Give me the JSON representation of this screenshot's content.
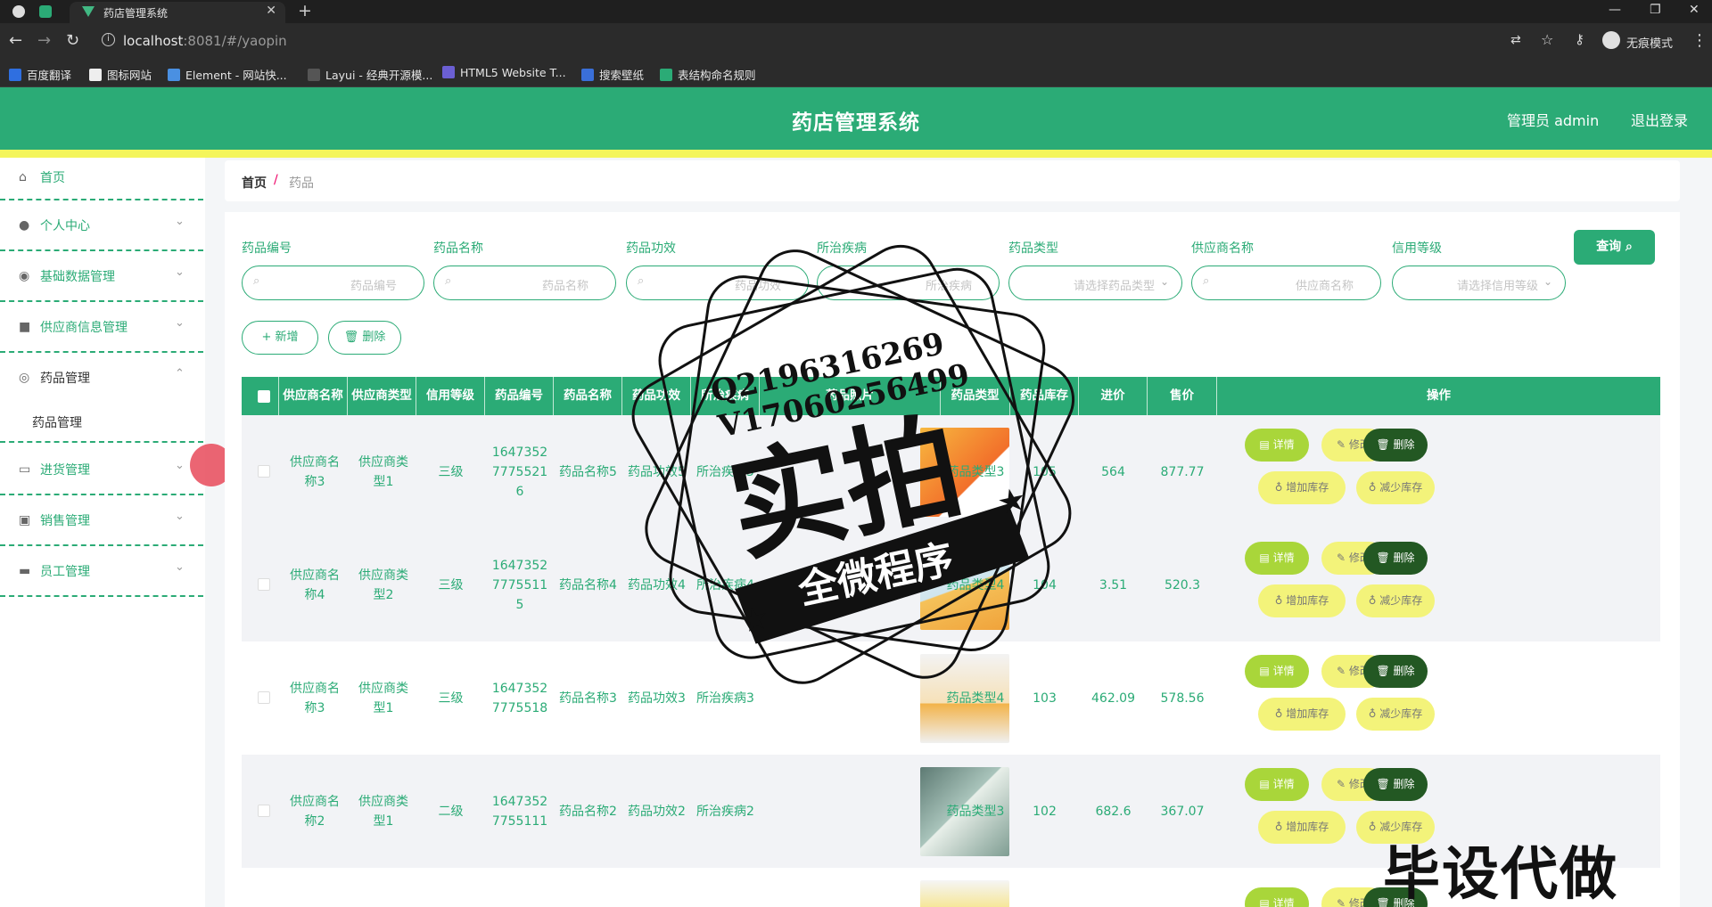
{
  "browser": {
    "tab_title": "药店管理系统",
    "url_host": "localhost",
    "url_rest": ":8081/#/yaopin",
    "incognito_label": "无痕模式",
    "bookmarks": [
      "百度翻译",
      "图标网站",
      "Element - 网站快...",
      "Layui - 经典开源模...",
      "HTML5 Website T...",
      "搜索壁纸",
      "表结构命名规则"
    ]
  },
  "header": {
    "title": "药店管理系统",
    "admin_label": "管理员 admin",
    "logout_label": "退出登录"
  },
  "sidebar": {
    "items": [
      {
        "label": "首页",
        "icon": "home-icon"
      },
      {
        "label": "个人中心",
        "icon": "user-icon"
      },
      {
        "label": "基础数据管理",
        "icon": "bulb-icon"
      },
      {
        "label": "供应商信息管理",
        "icon": "folder-icon"
      },
      {
        "label": "药品管理",
        "icon": "globe-icon"
      },
      {
        "label": "进货管理",
        "icon": "chat-icon"
      },
      {
        "label": "销售管理",
        "icon": "clipboard-icon"
      },
      {
        "label": "员工管理",
        "icon": "card-icon"
      }
    ],
    "submenu_label": "药品管理"
  },
  "breadcrumb": {
    "home": "首页",
    "separator": "/",
    "current": "药品"
  },
  "filters": {
    "labels": [
      "药品编号",
      "药品名称",
      "药品功效",
      "所治疾病",
      "药品类型",
      "供应商名称",
      "信用等级"
    ],
    "placeholders": [
      "药品编号",
      "药品名称",
      "药品功效",
      "所治疾病",
      "请选择药品类型",
      "供应商名称",
      "请选择信用等级"
    ],
    "query_label": "查询"
  },
  "actions": {
    "add_label": "+ 新增",
    "delete_label": "删除"
  },
  "table": {
    "headers": [
      "供应商名称",
      "供应商类型",
      "信用等级",
      "药品编号",
      "药品名称",
      "药品功效",
      "所治疾病",
      "药品照片",
      "药品类型",
      "药品库存",
      "进价",
      "售价",
      "操作"
    ],
    "rows": [
      {
        "supplier": "供应商名称3",
        "supplier_type": "供应商类型1",
        "credit": "三级",
        "code": "164735277755216",
        "name": "药品名称5",
        "effect": "药品功效5",
        "disease": "所治疾病5",
        "type": "药品类型3",
        "stock": "105",
        "cost": "564",
        "price": "877.77"
      },
      {
        "supplier": "供应商名称4",
        "supplier_type": "供应商类型2",
        "credit": "三级",
        "code": "164735277755115",
        "name": "药品名称4",
        "effect": "药品功效4",
        "disease": "所治疾病4",
        "type": "药品类型4",
        "stock": "104",
        "cost": "3.51",
        "price": "520.3"
      },
      {
        "supplier": "供应商名称3",
        "supplier_type": "供应商类型1",
        "credit": "三级",
        "code": "16473527775518",
        "name": "药品名称3",
        "effect": "药品功效3",
        "disease": "所治疾病3",
        "type": "药品类型4",
        "stock": "103",
        "cost": "462.09",
        "price": "578.56"
      },
      {
        "supplier": "供应商名称2",
        "supplier_type": "供应商类型1",
        "credit": "二级",
        "code": "16473527755111",
        "name": "药品名称2",
        "effect": "药品功效2",
        "disease": "所治疾病2",
        "type": "药品类型3",
        "stock": "102",
        "cost": "682.6",
        "price": "367.07"
      }
    ],
    "op_labels": {
      "detail": "详情",
      "edit": "修改",
      "delete": "删除",
      "add_stock": "增加库存",
      "reduce_stock": "减少库存"
    }
  },
  "watermark": {
    "line1": "Q2196316269",
    "line2": "V17060256499",
    "big": "实拍",
    "banner": "全微程序",
    "bottom": "毕设代做"
  },
  "colors": {
    "primary": "#2bab76",
    "accent_yellow": "#f4f55b",
    "dark_green": "#235823",
    "lime": "#a9d63a"
  }
}
